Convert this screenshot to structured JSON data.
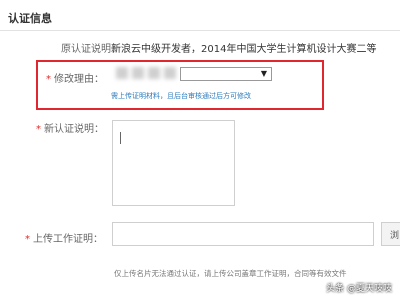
{
  "section": {
    "title": "认证信息"
  },
  "original": {
    "label": "原认证说明：",
    "value": "新浪云中级开发者，2014年中国大学生计算机设计大赛二等"
  },
  "modify": {
    "required_mark": "*",
    "label": "修改理由：",
    "hint": "需上传证明材料，且后台审核通过后方可修改"
  },
  "new_desc": {
    "required_mark": "*",
    "label": "新认证说明："
  },
  "upload": {
    "required_mark": "*",
    "label": "上传工作证明：",
    "browse_label": "浏"
  },
  "note": "仅上传名片无法通过认证，请上传公司盖章工作证明，合同等有效文件",
  "watermark": "头条 @夏天吱吱",
  "colors": {
    "highlight": "#e0262e",
    "required": "#e3292a",
    "hint": "#2e7cbd"
  }
}
